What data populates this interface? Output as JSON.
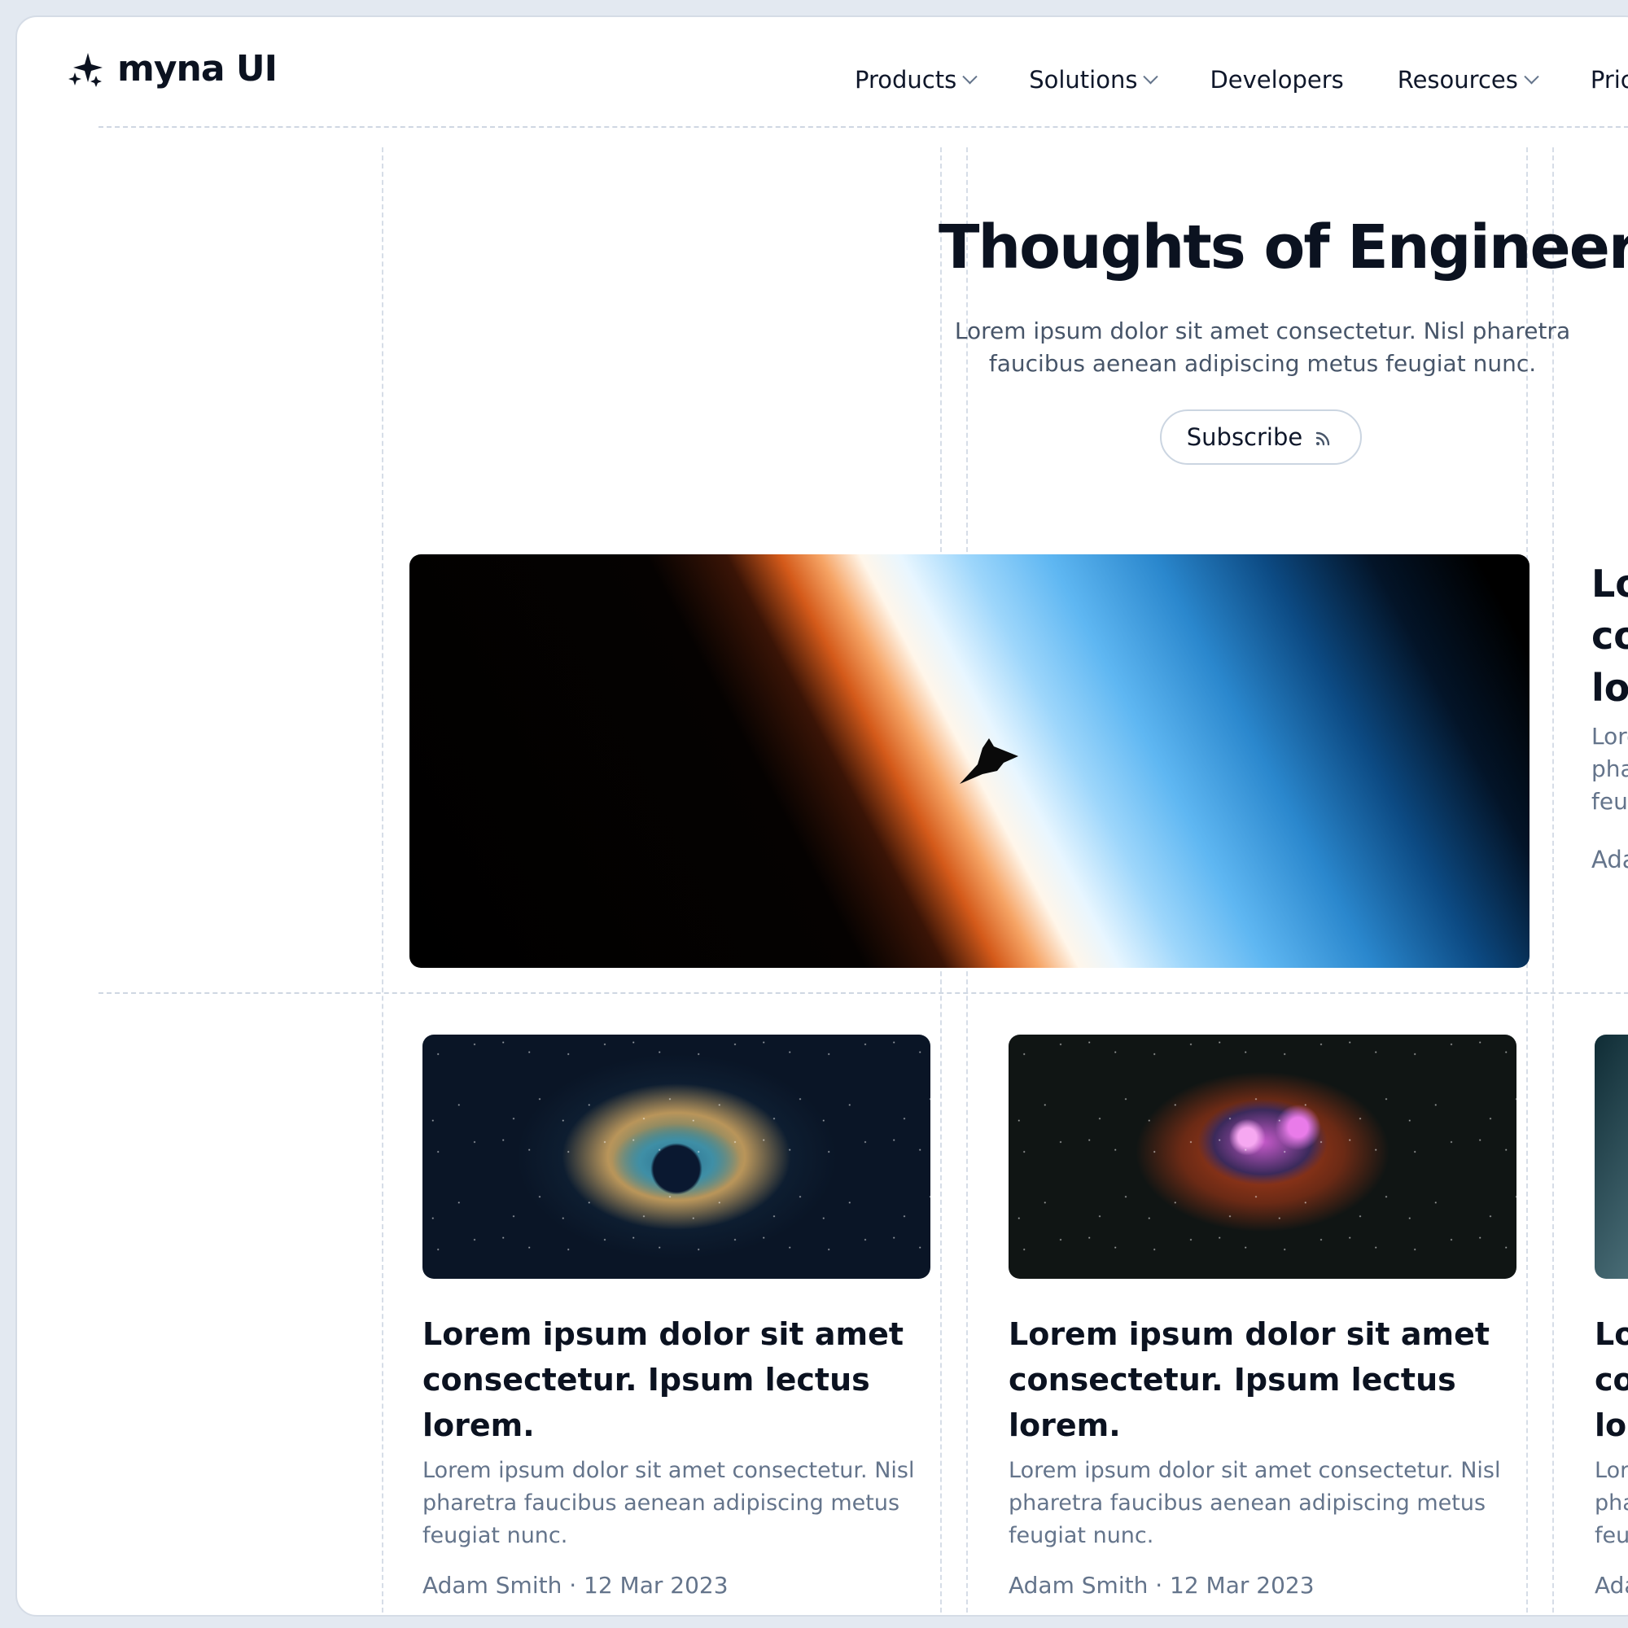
{
  "brand": {
    "name": "myna UI"
  },
  "nav": {
    "items": [
      {
        "label": "Products",
        "dropdown": true
      },
      {
        "label": "Solutions",
        "dropdown": true
      },
      {
        "label": "Developers",
        "dropdown": false
      },
      {
        "label": "Resources",
        "dropdown": true
      },
      {
        "label": "Pricing",
        "dropdown": false
      }
    ]
  },
  "hero": {
    "title": "Thoughts of Engineers.",
    "subtitle": "Lorem ipsum dolor sit amet consectetur. Nisl pharetra faucibus aenean adipiscing metus feugiat nunc.",
    "subscribe_label": "Subscribe"
  },
  "featured_side": {
    "title_lines": [
      "Lor",
      "cor",
      "lore"
    ],
    "excerpt_lines": [
      "Lorem",
      "phare",
      "feugi"
    ],
    "meta": "Adam"
  },
  "cards": [
    {
      "title": "Lorem ipsum dolor sit amet consectetur. Ipsum lectus lorem.",
      "excerpt": "Lorem ipsum dolor sit amet consectetur. Nisl pharetra faucibus aenean adipiscing metus feugiat nunc.",
      "meta": "Adam Smith · 12 Mar 2023"
    },
    {
      "title": "Lorem ipsum dolor sit amet consectetur. Ipsum lectus lorem.",
      "excerpt": "Lorem ipsum dolor sit amet consectetur. Nisl pharetra faucibus aenean adipiscing metus feugiat nunc.",
      "meta": "Adam Smith · 12 Mar 2023"
    },
    {
      "title_lines": [
        "Lor",
        "cor",
        "lore"
      ],
      "excerpt_lines": [
        "Lore",
        "phar",
        "feug"
      ],
      "meta": "Adar"
    }
  ],
  "colors": {
    "background": "#e3e9f1",
    "text": "#0b1220",
    "muted": "#64748b",
    "border": "#cbd5e1"
  },
  "icons": [
    "sparkle-logo-icon",
    "chevron-down-icon",
    "rss-icon"
  ]
}
